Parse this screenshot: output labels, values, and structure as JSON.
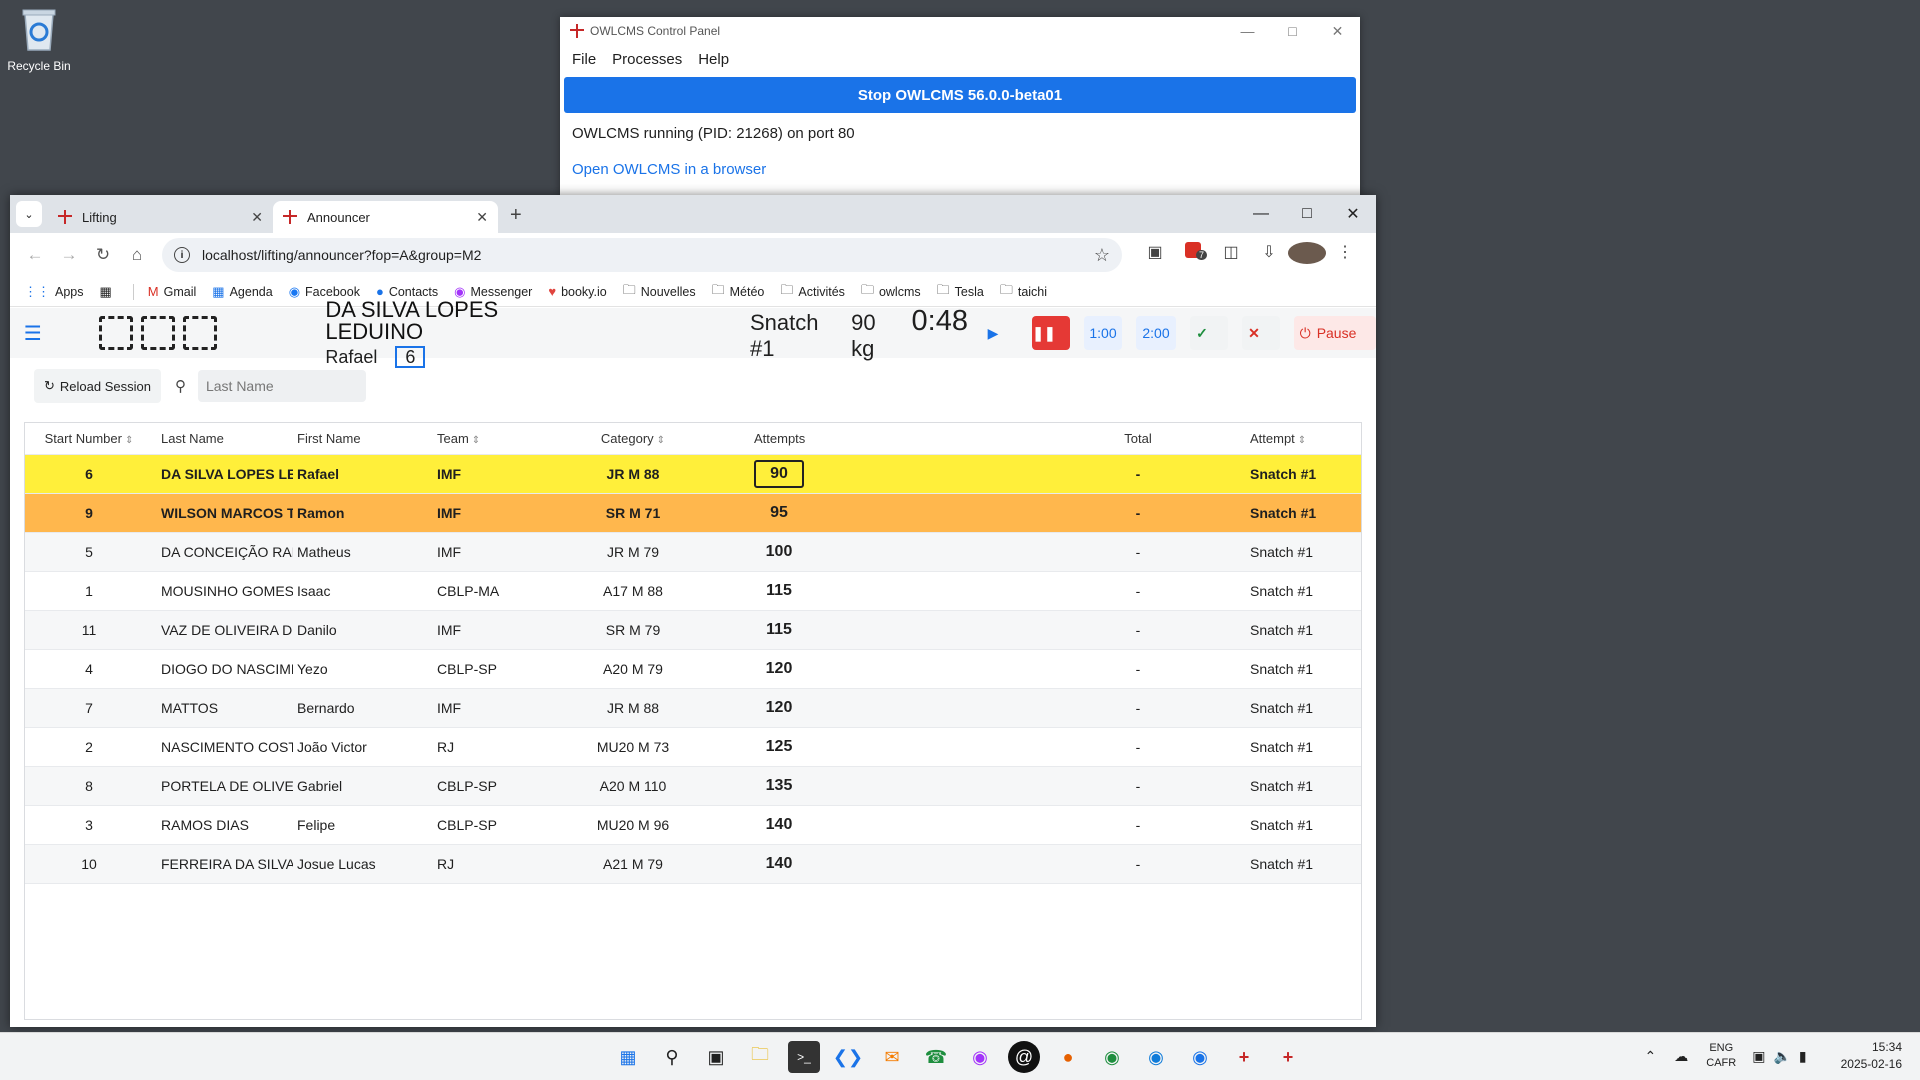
{
  "desktop": {
    "recycle_bin_label": "Recycle Bin"
  },
  "control_panel": {
    "title": "OWLCMS Control Panel",
    "menu": [
      "File",
      "Processes",
      "Help"
    ],
    "stop_button": "Stop OWLCMS 56.0.0-beta01",
    "status": "OWLCMS running (PID: 21268) on port 80",
    "open_link": "Open OWLCMS in a browser"
  },
  "browser": {
    "tabs": [
      {
        "label": "Lifting"
      },
      {
        "label": "Announcer"
      }
    ],
    "url": "localhost/lifting/announcer?fop=A&group=M2",
    "extension_badge": "7",
    "bookmarks": [
      {
        "label": "Apps",
        "icon": "apps-grid-icon"
      },
      {
        "label": "Gmail",
        "icon": "gmail-icon"
      },
      {
        "label": "Agenda",
        "icon": "calendar-icon"
      },
      {
        "label": "Facebook",
        "icon": "facebook-icon"
      },
      {
        "label": "Contacts",
        "icon": "contacts-icon"
      },
      {
        "label": "Messenger",
        "icon": "messenger-icon"
      },
      {
        "label": "booky.io",
        "icon": "heart-icon"
      },
      {
        "label": "Nouvelles",
        "icon": "folder-icon"
      },
      {
        "label": "Météo",
        "icon": "folder-icon"
      },
      {
        "label": "Activités",
        "icon": "folder-icon"
      },
      {
        "label": "owlcms",
        "icon": "folder-icon"
      },
      {
        "label": "Tesla",
        "icon": "folder-icon"
      },
      {
        "label": "taichi",
        "icon": "folder-icon"
      }
    ]
  },
  "announcer": {
    "athlete_last_name": "DA SILVA LOPES LEDUINO",
    "athlete_first_name": "Rafael",
    "start_number": "6",
    "attempt": "Snatch #1",
    "weight": "90 kg",
    "clock": "0:48",
    "timer_1": "1:00",
    "timer_2": "2:00",
    "pause_label": "Pause",
    "reload_label": "Reload Session",
    "search_placeholder": "Last Name",
    "columns": {
      "start": "Start Number",
      "last": "Last Name",
      "first": "First Name",
      "team": "Team",
      "category": "Category",
      "attempts": "Attempts",
      "total": "Total",
      "attempt": "Attempt"
    },
    "rows": [
      {
        "start": "6",
        "last": "DA SILVA LOPES LED",
        "first": "Rafael",
        "team": "IMF",
        "category": "JR M 88",
        "weight": "90",
        "total": "-",
        "attempt": "Snatch #1",
        "state": "current"
      },
      {
        "start": "9",
        "last": "WILSON MARCOS TC",
        "first": "Ramon",
        "team": "IMF",
        "category": "SR M 71",
        "weight": "95",
        "total": "-",
        "attempt": "Snatch #1",
        "state": "next"
      },
      {
        "start": "5",
        "last": "DA CONCEIÇÃO RAM",
        "first": "Matheus",
        "team": "IMF",
        "category": "JR M 79",
        "weight": "100",
        "total": "-",
        "attempt": "Snatch #1",
        "state": ""
      },
      {
        "start": "1",
        "last": "MOUSINHO GOMES C",
        "first": "Isaac",
        "team": "CBLP-MA",
        "category": "A17 M 88",
        "weight": "115",
        "total": "-",
        "attempt": "Snatch #1",
        "state": ""
      },
      {
        "start": "11",
        "last": "VAZ DE OLIVEIRA DE S",
        "first": "Danilo",
        "team": "IMF",
        "category": "SR M 79",
        "weight": "115",
        "total": "-",
        "attempt": "Snatch #1",
        "state": ""
      },
      {
        "start": "4",
        "last": "DIOGO DO NASCIMEN",
        "first": "Yezo",
        "team": "CBLP-SP",
        "category": "A20 M 79",
        "weight": "120",
        "total": "-",
        "attempt": "Snatch #1",
        "state": ""
      },
      {
        "start": "7",
        "last": "MATTOS",
        "first": "Bernardo",
        "team": "IMF",
        "category": "JR M 88",
        "weight": "120",
        "total": "-",
        "attempt": "Snatch #1",
        "state": ""
      },
      {
        "start": "2",
        "last": "NASCIMENTO COSTA",
        "first": "João Victor",
        "team": "RJ",
        "category": "MU20 M 73",
        "weight": "125",
        "total": "-",
        "attempt": "Snatch #1",
        "state": ""
      },
      {
        "start": "8",
        "last": "PORTELA DE OLIVEIRA",
        "first": "Gabriel",
        "team": "CBLP-SP",
        "category": "A20 M 110",
        "weight": "135",
        "total": "-",
        "attempt": "Snatch #1",
        "state": ""
      },
      {
        "start": "3",
        "last": "RAMOS DIAS",
        "first": "Felipe",
        "team": "CBLP-SP",
        "category": "MU20 M 96",
        "weight": "140",
        "total": "-",
        "attempt": "Snatch #1",
        "state": ""
      },
      {
        "start": "10",
        "last": "FERREIRA DA SILVA",
        "first": "Josue Lucas",
        "team": "RJ",
        "category": "A21 M 79",
        "weight": "140",
        "total": "-",
        "attempt": "Snatch #1",
        "state": ""
      }
    ]
  },
  "taskbar": {
    "lang_1": "ENG",
    "lang_2": "CAFR",
    "time": "15:34",
    "date": "2025-02-16"
  }
}
